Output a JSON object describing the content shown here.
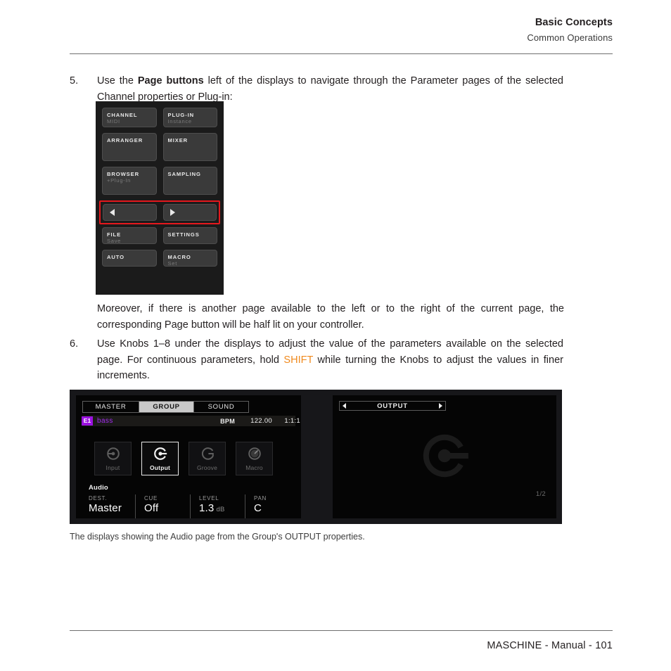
{
  "header": {
    "title": "Basic Concepts",
    "subtitle": "Common Operations"
  },
  "steps": [
    {
      "number": "5.",
      "text_part1": "Use the ",
      "bold": "Page buttons",
      "text_part2": " left of the displays to navigate through the Parameter pages of the selected Channel properties or Plug-in:"
    },
    {
      "number": "6.",
      "text_part1": "Use Knobs 1–8 under the displays to adjust the value of the parameters available on the selected page. For continuous parameters, hold ",
      "highlight": "SHIFT",
      "text_part2": " while turning the Knobs to adjust the values in finer increments."
    }
  ],
  "paragraph": "Moreover, if there is another page available to the left or to the right of the current page, the corresponding Page button will be half lit on your controller.",
  "caption": "The displays showing the Audio page from the Group's OUTPUT properties.",
  "controller": {
    "highlight_color": "#e4181d",
    "buttons": [
      {
        "label": "CHANNEL",
        "sublabel": "MIDI"
      },
      {
        "label": "PLUG-IN",
        "sublabel": "Instance"
      },
      {
        "label": "ARRANGER",
        "sublabel": ""
      },
      {
        "label": "MIXER",
        "sublabel": ""
      },
      {
        "label": "BROWSER",
        "sublabel": "+Plug-In"
      },
      {
        "label": "SAMPLING",
        "sublabel": ""
      },
      {
        "label": "FILE",
        "sublabel": "Save"
      },
      {
        "label": "SETTINGS",
        "sublabel": ""
      },
      {
        "label": "AUTO",
        "sublabel": ""
      },
      {
        "label": "MACRO",
        "sublabel": "Set"
      }
    ],
    "page_left_icon": "triangle-left-icon",
    "page_right_icon": "triangle-right-icon"
  },
  "display_left": {
    "tabs": [
      {
        "label": "MASTER",
        "selected": false
      },
      {
        "label": "GROUP",
        "selected": true
      },
      {
        "label": "SOUND",
        "selected": false
      }
    ],
    "group_badge": "E1",
    "group_name": "bass",
    "bpm_label": "BPM",
    "bpm_value": "122.00",
    "position": "1:1:1",
    "accent_color": "#9b11e0",
    "icon_buttons": [
      {
        "label": "Input",
        "icon": "input-icon",
        "selected": false
      },
      {
        "label": "Output",
        "icon": "output-icon",
        "selected": true
      },
      {
        "label": "Groove",
        "icon": "groove-icon",
        "selected": false
      },
      {
        "label": "Macro",
        "icon": "macro-knob-icon",
        "selected": false
      }
    ],
    "section_title": "Audio",
    "parameters": [
      {
        "label": "DEST.",
        "value": "Master",
        "unit": ""
      },
      {
        "label": "CUE",
        "value": "Off",
        "unit": ""
      },
      {
        "label": "LEVEL",
        "value": "1.3",
        "unit": "dB"
      },
      {
        "label": "PAN",
        "value": "C",
        "unit": ""
      }
    ]
  },
  "display_right": {
    "page_title": "OUTPUT",
    "prev_icon": "triangle-left-icon",
    "next_icon": "triangle-right-icon",
    "watermark_icon": "output-icon",
    "page_count": "1/2"
  },
  "footer": {
    "text": "MASCHINE - Manual - 101"
  }
}
